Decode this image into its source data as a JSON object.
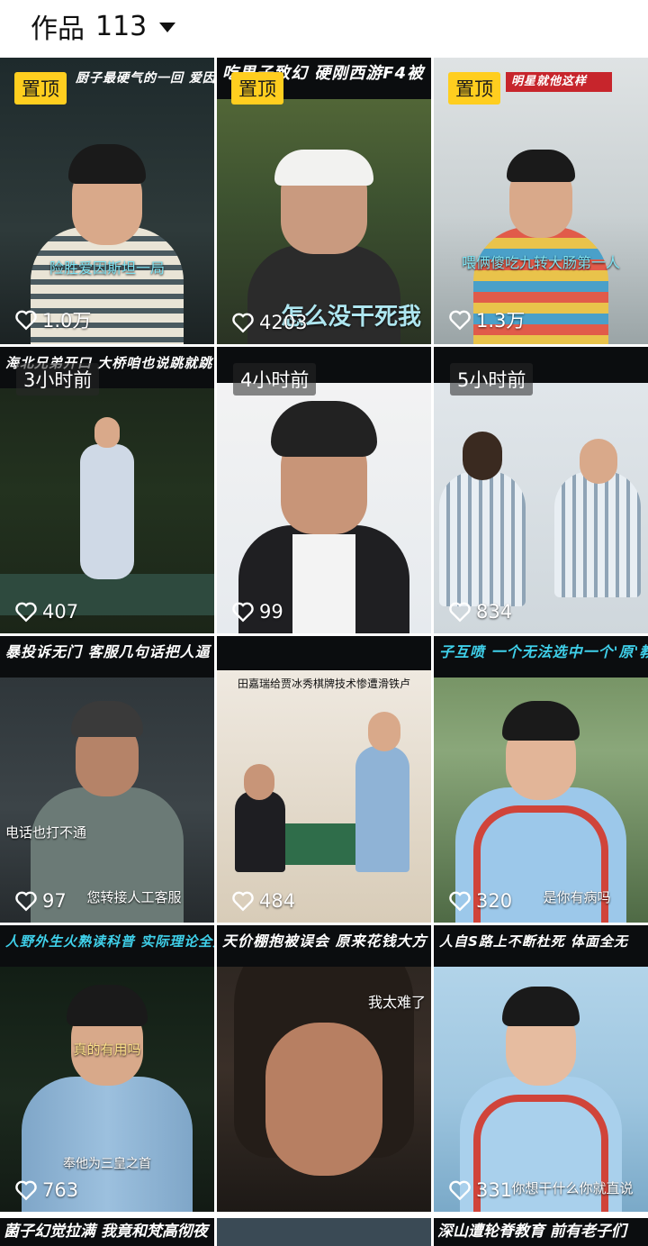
{
  "header": {
    "title": "作品",
    "count": "113"
  },
  "tiles": [
    {
      "pin": "置顶",
      "banner": "厨子最硬气的一回 爱因斯坦会炒菜！",
      "caption": "险胜爱因斯坦一局",
      "likes": "1.0万"
    },
    {
      "pin": "置顶",
      "banner": "吃男子致幻 硬刚西游F4被",
      "caption": "怎么没干死我",
      "likes": "4203"
    },
    {
      "pin": "置顶",
      "banner": "明星就他这样",
      "caption": "喂俩傻吃九转大肠第一人",
      "likes": "1.3万"
    },
    {
      "time": "3小时前",
      "banner": "海北兄弟开口 大桥咱也说跳就跳",
      "caption": "",
      "likes": "407"
    },
    {
      "time": "4小时前",
      "banner": "",
      "caption": "",
      "likes": "99"
    },
    {
      "time": "5小时前",
      "banner": "",
      "caption": "",
      "likes": "834"
    },
    {
      "banner": "暴投诉无门 客服几句话把人逼",
      "caption": "电话也打不通",
      "caption2": "您转接人工客服",
      "likes": "97"
    },
    {
      "banner": "",
      "caption": "田嘉瑞给贾冰秀棋牌技术惨遭滑铁卢",
      "likes": "484"
    },
    {
      "banner": "子互喷 一个无法选中一个'原'教",
      "caption": "是你有病吗",
      "likes": "320"
    },
    {
      "banner": "人野外生火熟读科普 实际理论全无",
      "caption": "真的有用吗",
      "caption2": "奉他为三皇之首",
      "likes": "763"
    },
    {
      "banner": "天价棚抱被误会 原来花钱大方",
      "caption": "我太难了",
      "likes": ""
    },
    {
      "banner": "人自S路上不断杜死 体面全无",
      "caption": "你想干什么你就直说",
      "likes": "331"
    }
  ],
  "bottom_strip": [
    "菌子幻觉拉满 我竟和梵高彻夜",
    "",
    "深山遭轮脊教育 前有老子们"
  ],
  "colors": {
    "pin_bg": "#ffce1f",
    "banner_text": "#3fd0ea",
    "background": "#ffffff"
  }
}
